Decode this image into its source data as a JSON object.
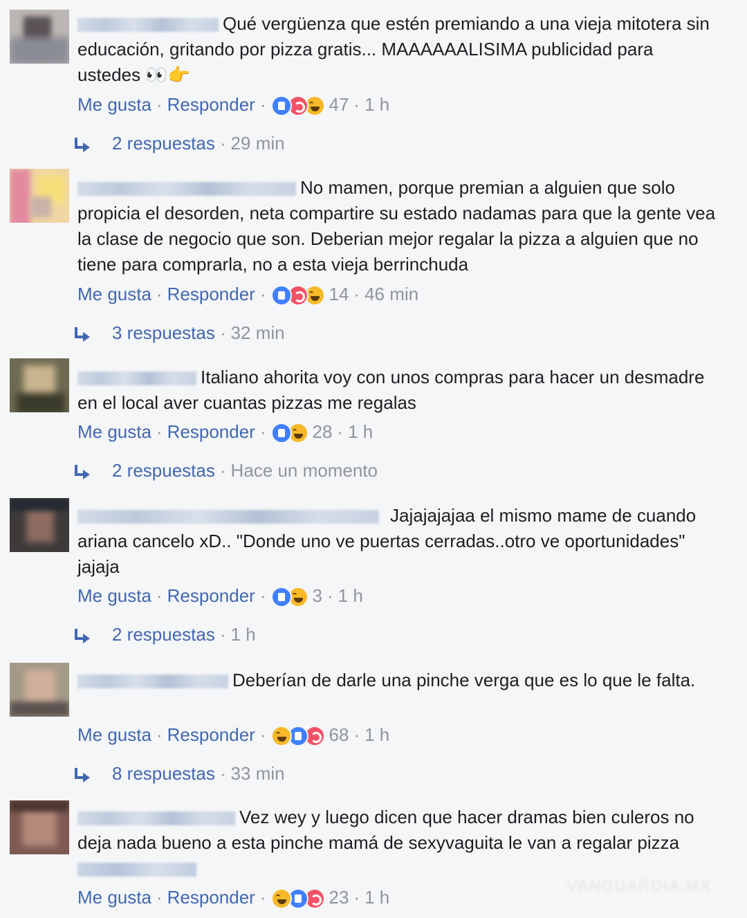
{
  "colors": {
    "link": "#4267b2",
    "meta": "#90949c",
    "background": "#f5f6f7",
    "text": "#1c1e21"
  },
  "labels": {
    "like": "Me gusta",
    "reply": "Responder",
    "separator": "·"
  },
  "comments": [
    {
      "text": "Qué vergüenza que estén premiando a una vieja mitotera sin educación, gritando por pizza gratis... MAAAAAALISIMA publicidad para ustedes 👀👉",
      "reactions": [
        "like-icon",
        "love-icon",
        "haha-icon"
      ],
      "reaction_count": "47",
      "time": "1 h",
      "replies_label": "2 respuestas",
      "replies_time": "29 min"
    },
    {
      "text": "No mamen, porque premian a alguien que solo propicia el desorden, neta compartire su estado nadamas para que la gente vea la clase de negocio que son. Deberian mejor regalar la pizza a alguien que no tiene para comprarla, no a esta vieja berrinchuda",
      "reactions": [
        "like-icon",
        "love-icon",
        "haha-icon"
      ],
      "reaction_count": "14",
      "time": "46 min",
      "replies_label": "3 respuestas",
      "replies_time": "32 min"
    },
    {
      "text": "Italiano ahorita voy con unos compras para hacer un desmadre en el local aver cuantas pizzas me regalas",
      "reactions": [
        "like-icon",
        "haha-icon"
      ],
      "reaction_count": "28",
      "time": "1 h",
      "replies_label": "2 respuestas",
      "replies_time": "Hace un momento"
    },
    {
      "text": "Jajajajajaa el mismo mame de cuando ariana cancelo xD.. \"Donde uno ve puertas cerradas..otro ve oportunidades\" jajaja",
      "reactions": [
        "like-icon",
        "haha-icon"
      ],
      "reaction_count": "3",
      "time": "1 h",
      "replies_label": "2 respuestas",
      "replies_time": "1 h"
    },
    {
      "text": "Deberían de darle una pinche verga que es lo que le falta.",
      "reactions": [
        "haha-icon",
        "like-icon",
        "love-icon"
      ],
      "reaction_count": "68",
      "time": "1 h",
      "replies_label": "8 respuestas",
      "replies_time": "33 min"
    },
    {
      "text": "Vez wey y luego dicen que hacer dramas bien culeros no deja nada bueno a esta pinche mamá de sexyvaguita le van a regalar pizza",
      "reactions": [
        "haha-icon",
        "like-icon",
        "love-icon"
      ],
      "reaction_count": "23",
      "time": "1 h"
    }
  ],
  "watermark": "VANGUARDIA.MX"
}
